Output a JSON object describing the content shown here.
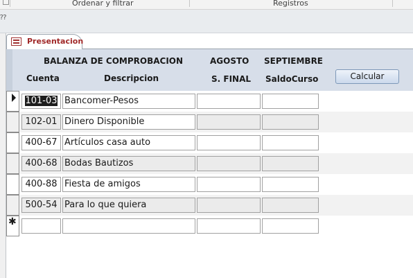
{
  "ribbon": {
    "groups": [
      "Ordenar y filtrar",
      "Registros"
    ]
  },
  "tab": {
    "label": "Presentacion"
  },
  "header": {
    "title": "BALANZA DE COMPROBACION",
    "cuenta": "Cuenta",
    "descripcion": "Descripcion",
    "month1": "AGOSTO",
    "col1": "S. FINAL",
    "month2": "SEPTIEMBRE",
    "col2": "SaldoCurso"
  },
  "button": {
    "calcular": "Calcular"
  },
  "rows": [
    {
      "cuenta": "101-03",
      "descripcion": "Bancomer-Pesos",
      "s_final": "",
      "saldo_curso": ""
    },
    {
      "cuenta": "102-01",
      "descripcion": "Dinero Disponible",
      "s_final": "",
      "saldo_curso": ""
    },
    {
      "cuenta": "400-67",
      "descripcion": "Artículos casa auto",
      "s_final": "",
      "saldo_curso": ""
    },
    {
      "cuenta": "400-68",
      "descripcion": "Bodas Bautizos",
      "s_final": "",
      "saldo_curso": ""
    },
    {
      "cuenta": "400-88",
      "descripcion": "Fiesta de amigos",
      "s_final": "",
      "saldo_curso": ""
    },
    {
      "cuenta": "500-54",
      "descripcion": "Para lo que quiera",
      "s_final": "",
      "saldo_curso": ""
    }
  ],
  "new_row": {
    "cuenta": "",
    "descripcion": "",
    "s_final": "",
    "saldo_curso": ""
  },
  "colors": {
    "tab_text": "#a02828",
    "header_bg": "#d7dee9",
    "button_border": "#7d98b8"
  }
}
